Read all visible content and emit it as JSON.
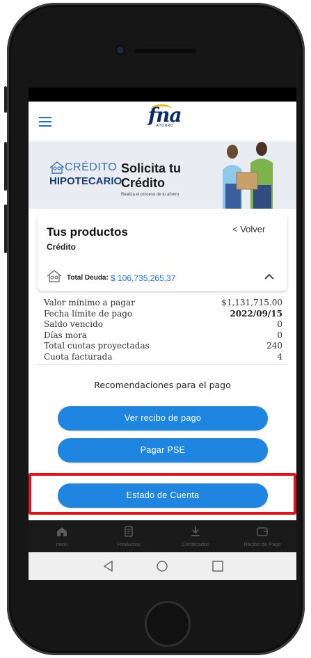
{
  "header": {
    "logo_text": "fna",
    "logo_sub": "AHORRO"
  },
  "banner": {
    "brand_small": "CRÉDITO",
    "brand_big": "HIPOTECARIO",
    "title_line1": "Solicita tu",
    "title_line2": "Crédito",
    "subtitle": "Realiza el proceso de tu ahorro"
  },
  "products": {
    "title": "Tus productos",
    "product_type": "Crédito",
    "back_label": "< Volver",
    "total_debt_label": "Total Deuda:",
    "total_debt_value": "$ 106,735,265.37"
  },
  "details": [
    {
      "label": "Valor mínimo a pagar",
      "value": "$1,131,715.00",
      "bold": false
    },
    {
      "label": "Fecha límite de pago",
      "value": "2022/09/15",
      "bold": true
    },
    {
      "label": "Saldo vencido",
      "value": "0",
      "bold": false
    },
    {
      "label": "Días mora",
      "value": "0",
      "bold": false
    },
    {
      "label": "Total cuotas proyectadas",
      "value": "240",
      "bold": false
    },
    {
      "label": "Cuota facturada",
      "value": "4",
      "bold": false
    }
  ],
  "recommendations": {
    "heading": "Recomendaciones para el pago",
    "btn_receipt": "Ver recibo de pago",
    "btn_pse": "Pagar PSE",
    "btn_statement": "Estado de Cuenta"
  },
  "bottom_nav": [
    {
      "label": "Inicio",
      "icon": "home-icon"
    },
    {
      "label": "Productos",
      "icon": "document-icon"
    },
    {
      "label": "Certificados",
      "icon": "download-icon"
    },
    {
      "label": "Recibo de Pago",
      "icon": "wallet-icon"
    }
  ],
  "colors": {
    "brand_blue": "#1e86e0",
    "highlight_red": "#e3121a",
    "logo_navy": "#0b2c6b",
    "logo_gold": "#f3b51b"
  }
}
